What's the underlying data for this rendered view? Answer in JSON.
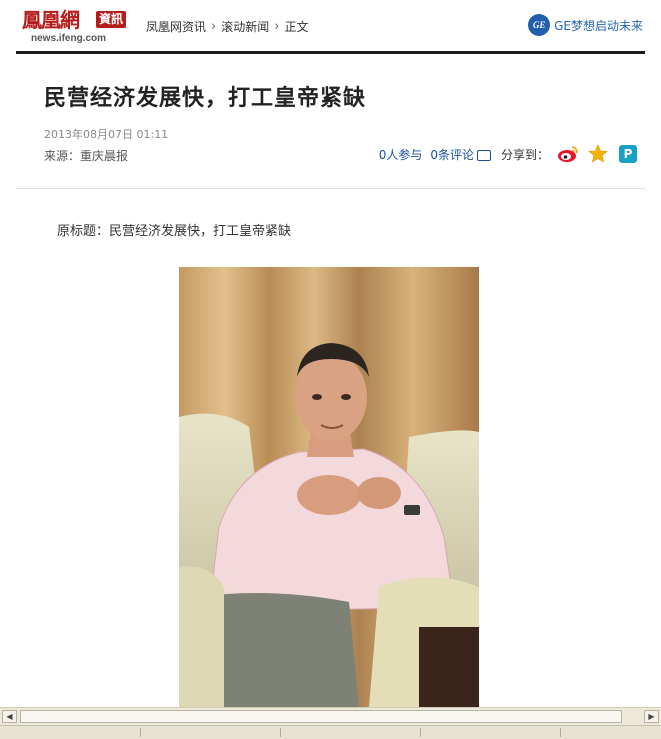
{
  "header": {
    "logo_cn": "鳳凰網",
    "logo_tag": "資訊",
    "logo_url": "news.ifeng.com",
    "breadcrumb": [
      "凤凰网资讯",
      "滚动新闻",
      "正文"
    ],
    "ge_text": "GE梦想启动未来",
    "ge_icon": "GE"
  },
  "article": {
    "title": "民营经济发展快，打工皇帝紧缺",
    "date": "2013年08月07日  01:11",
    "source": "来源：重庆晨报",
    "participants": "0人参与",
    "comments": "0条评论",
    "share_label": "分享到：",
    "subtitle": "原标题：民营经济发展快，打工皇帝紧缺",
    "share_icons": [
      "weibo-icon",
      "qzone-star-icon",
      "pengyou-icon"
    ]
  },
  "colors": {
    "brand_red": "#b51c1c",
    "link_blue": "#1a4f9e",
    "ge_blue": "#1f5fae"
  }
}
